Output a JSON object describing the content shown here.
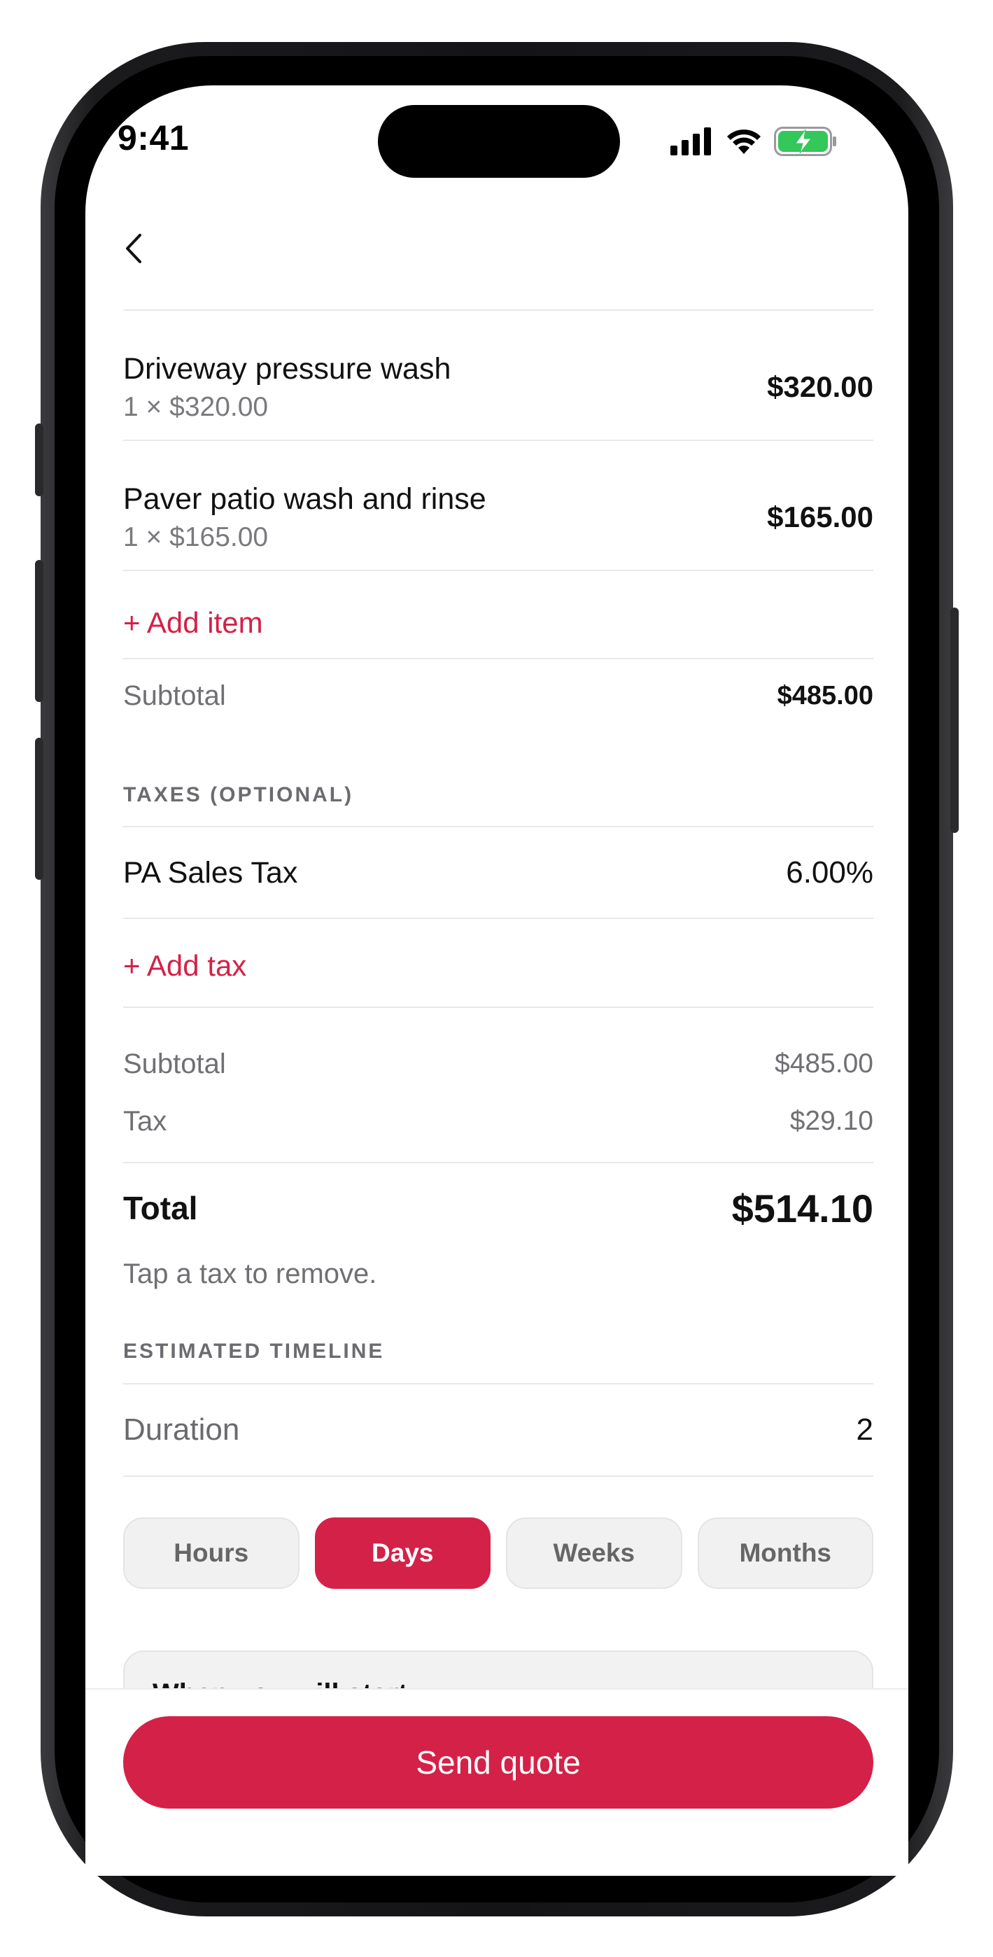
{
  "status_bar": {
    "time": "9:41"
  },
  "line_items": [
    {
      "name": "Driveway pressure wash",
      "detail": "1 × $320.00",
      "price": "$320.00"
    },
    {
      "name": "Paver patio wash and rinse",
      "detail": "1 × $165.00",
      "price": "$165.00"
    }
  ],
  "add_item_label": "+ Add item",
  "subtotal_row": {
    "label": "Subtotal",
    "value": "$485.00"
  },
  "taxes": {
    "heading": "TAXES (OPTIONAL)",
    "items": [
      {
        "name": "PA Sales Tax",
        "rate": "6.00%"
      }
    ],
    "add_label": "+ Add tax"
  },
  "summary": {
    "subtotal_label": "Subtotal",
    "subtotal_value": "$485.00",
    "tax_label": "Tax",
    "tax_value": "$29.10",
    "total_label": "Total",
    "total_value": "$514.10",
    "hint": "Tap a tax to remove."
  },
  "timeline": {
    "heading": "ESTIMATED TIMELINE",
    "duration_label": "Duration",
    "duration_value": "2",
    "units": [
      "Hours",
      "Days",
      "Weeks",
      "Months"
    ],
    "selected_unit": "Days"
  },
  "next_card_partial_text": "When you will start",
  "send_button_label": "Send quote",
  "colors": {
    "accent": "#d42148",
    "battery": "#34c759"
  },
  "icons": [
    "back-chevron-icon",
    "cellular-signal-icon",
    "wifi-icon",
    "battery-charging-icon"
  ]
}
